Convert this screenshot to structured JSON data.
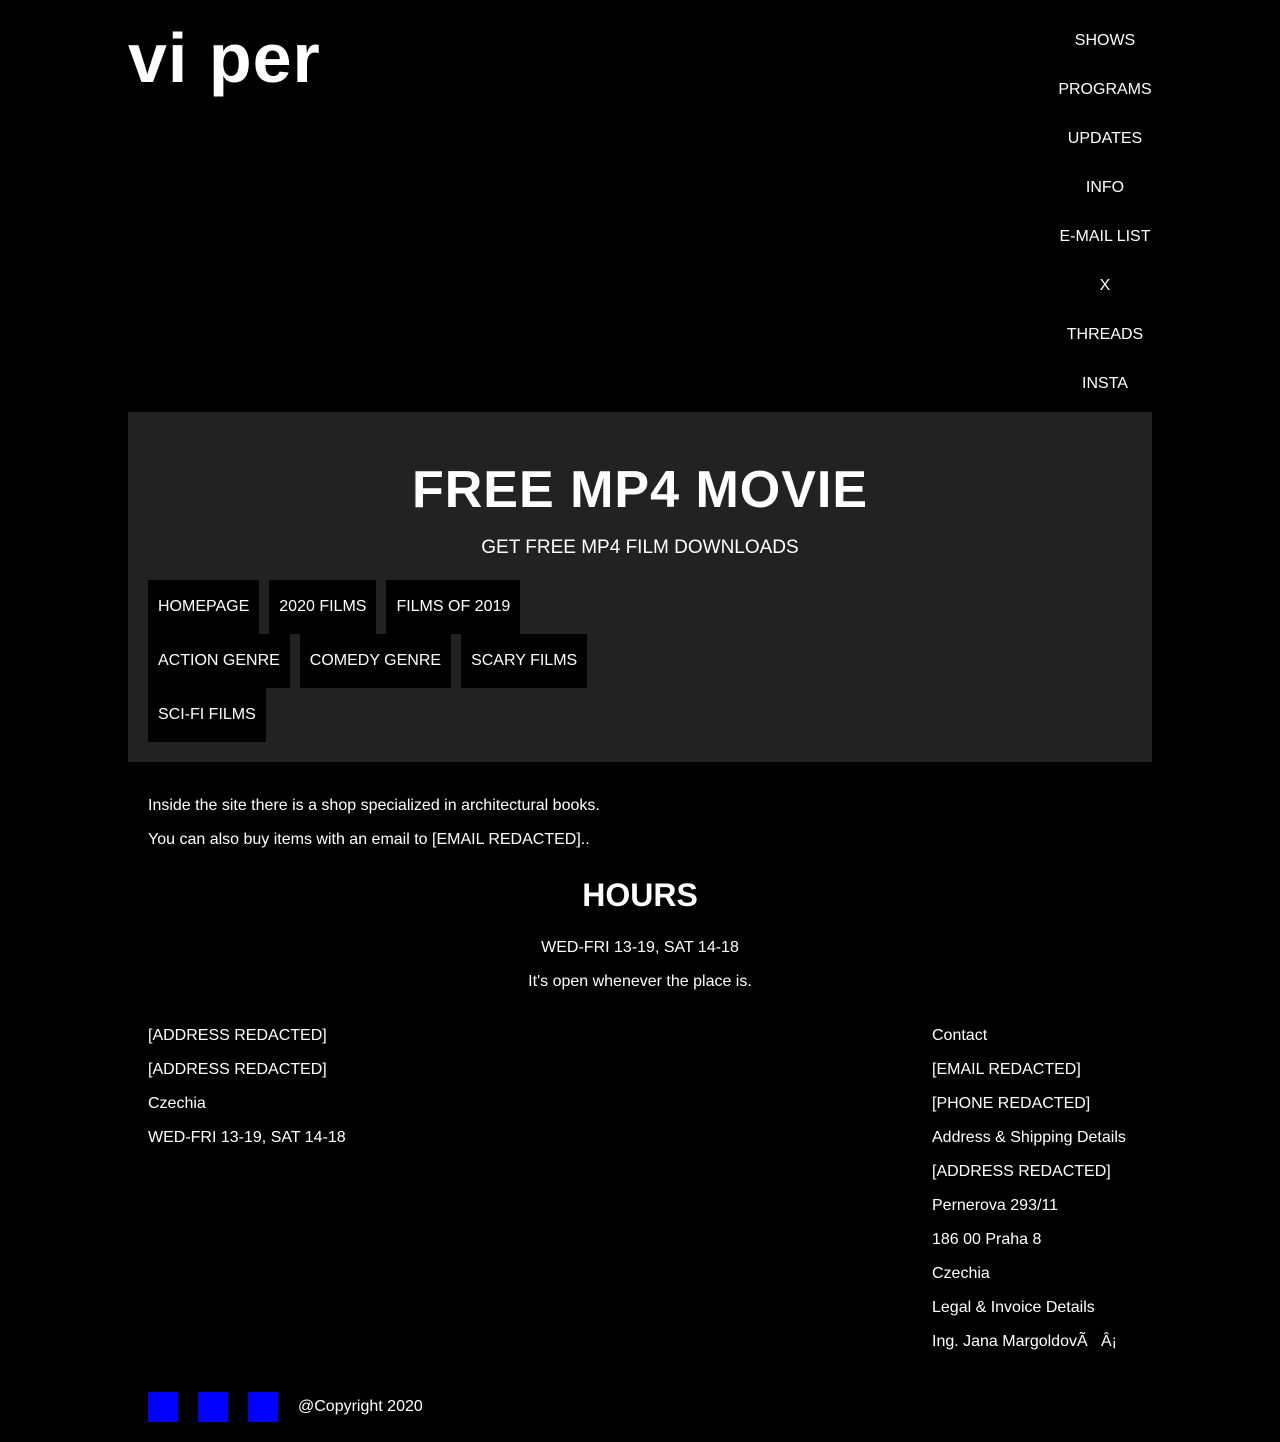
{
  "logo": "vi per",
  "top_nav": [
    "SHOWS",
    "PROGRAMS",
    "UPDATES",
    "INFO",
    "E-MAIL LIST",
    "X",
    "THREADS",
    "INSTA"
  ],
  "hero": {
    "title": "FREE MP4 MOVIE",
    "subtitle": "GET FREE MP4 FILM DOWNLOADS"
  },
  "category_nav": [
    [
      "HOMEPAGE",
      "2020 FILMS",
      "FILMS OF 2019"
    ],
    [
      "ACTION GENRE",
      "COMEDY GENRE",
      "SCARY FILMS"
    ],
    [
      "SCI-FI FILMS"
    ]
  ],
  "intro": [
    "Inside the site there is a shop specialized in architectural books.",
    "You can also buy items with an email to [EMAIL REDACTED].."
  ],
  "hours": {
    "title": "HOURS",
    "schedule": "WED-FRI 13-19, SAT 14-18",
    "note": "It's open whenever the place is."
  },
  "address_left": [
    "[ADDRESS REDACTED]",
    "[ADDRESS REDACTED]",
    "Czechia",
    "WED-FRI 13-19, SAT 14-18"
  ],
  "contact_right": [
    "Contact",
    "[EMAIL REDACTED]",
    "[PHONE REDACTED]",
    "Address & Shipping Details",
    "[ADDRESS REDACTED]",
    "Pernerova 293/11",
    "186 00 Praha 8",
    "Czechia",
    "Legal & Invoice Details",
    "Ing. Jana MargoldovÃ   Â¡"
  ],
  "footer": {
    "social_icons": [
      "social-icon-1",
      "social-icon-2",
      "social-icon-3"
    ],
    "social_color": "#0000ff",
    "copyright": "@Copyright 2020"
  }
}
